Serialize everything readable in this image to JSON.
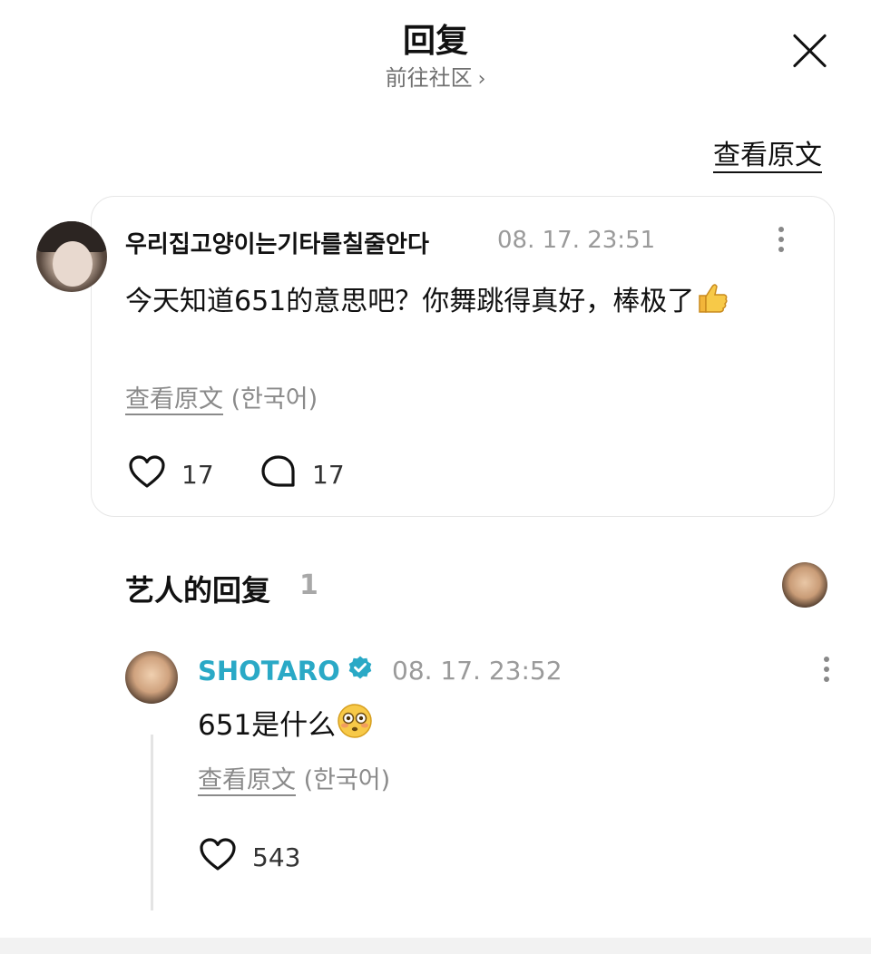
{
  "header": {
    "title": "回复",
    "community_link": "前往社区",
    "view_original": "查看原文"
  },
  "comment": {
    "username": "우리집고양이는기타를칠줄안다",
    "timestamp": "08. 17. 23:51",
    "text": "今天知道651的意思吧？你舞跳得真好，棒极了",
    "emoji": "thumbs-up",
    "translate_link": "查看原文",
    "translate_lang": "(한국어)",
    "likes": "17",
    "replies": "17"
  },
  "artist_replies": {
    "title": "艺人的回复",
    "count": "1",
    "reply": {
      "username": "SHOTARO",
      "verified": true,
      "timestamp": "08. 17. 23:52",
      "text": "651是什么",
      "emoji": "flushed-face",
      "translate_link": "查看原文",
      "translate_lang": "(한국어)",
      "likes": "543"
    }
  },
  "colors": {
    "artist_name": "#2aa9c6",
    "muted_text": "#9a9a9a",
    "card_border": "#e6e6e6"
  }
}
